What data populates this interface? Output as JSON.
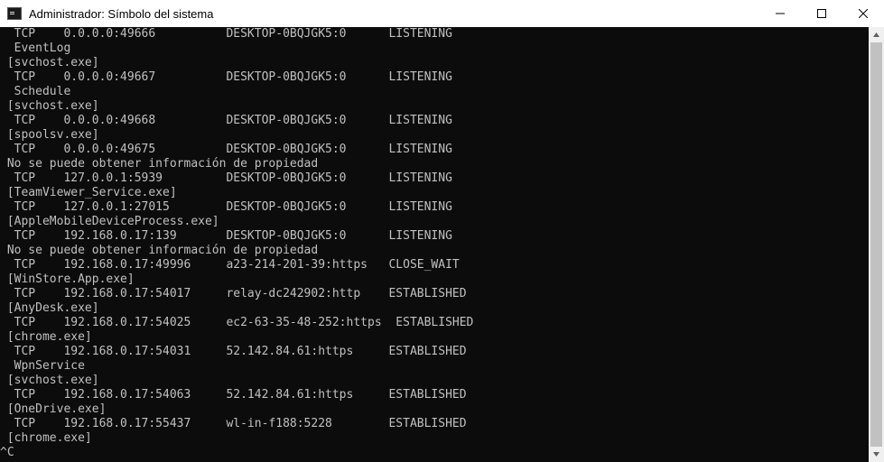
{
  "window": {
    "title": "Administrador: Símbolo del sistema",
    "controls": {
      "minimize": "minimize",
      "maximize": "maximize",
      "close": "close"
    }
  },
  "console": {
    "lines": [
      "  TCP    0.0.0.0:49666          DESKTOP-0BQJGK5:0      LISTENING",
      "  EventLog",
      " [svchost.exe]",
      "  TCP    0.0.0.0:49667          DESKTOP-0BQJGK5:0      LISTENING",
      "  Schedule",
      " [svchost.exe]",
      "  TCP    0.0.0.0:49668          DESKTOP-0BQJGK5:0      LISTENING",
      " [spoolsv.exe]",
      "  TCP    0.0.0.0:49675          DESKTOP-0BQJGK5:0      LISTENING",
      " No se puede obtener información de propiedad",
      "  TCP    127.0.0.1:5939         DESKTOP-0BQJGK5:0      LISTENING",
      " [TeamViewer_Service.exe]",
      "  TCP    127.0.0.1:27015        DESKTOP-0BQJGK5:0      LISTENING",
      " [AppleMobileDeviceProcess.exe]",
      "  TCP    192.168.0.17:139       DESKTOP-0BQJGK5:0      LISTENING",
      " No se puede obtener información de propiedad",
      "  TCP    192.168.0.17:49996     a23-214-201-39:https   CLOSE_WAIT",
      " [WinStore.App.exe]",
      "  TCP    192.168.0.17:54017     relay-dc242902:http    ESTABLISHED",
      " [AnyDesk.exe]",
      "  TCP    192.168.0.17:54025     ec2-63-35-48-252:https  ESTABLISHED",
      " [chrome.exe]",
      "  TCP    192.168.0.17:54031     52.142.84.61:https     ESTABLISHED",
      "  WpnService",
      " [svchost.exe]",
      "  TCP    192.168.0.17:54063     52.142.84.61:https     ESTABLISHED",
      " [OneDrive.exe]",
      "  TCP    192.168.0.17:55437     wl-in-f188:5228        ESTABLISHED",
      " [chrome.exe]",
      "^C"
    ]
  },
  "colors": {
    "console_bg": "#0c0c0c",
    "console_text": "#c0c0c0",
    "titlebar_bg": "#ffffff"
  }
}
